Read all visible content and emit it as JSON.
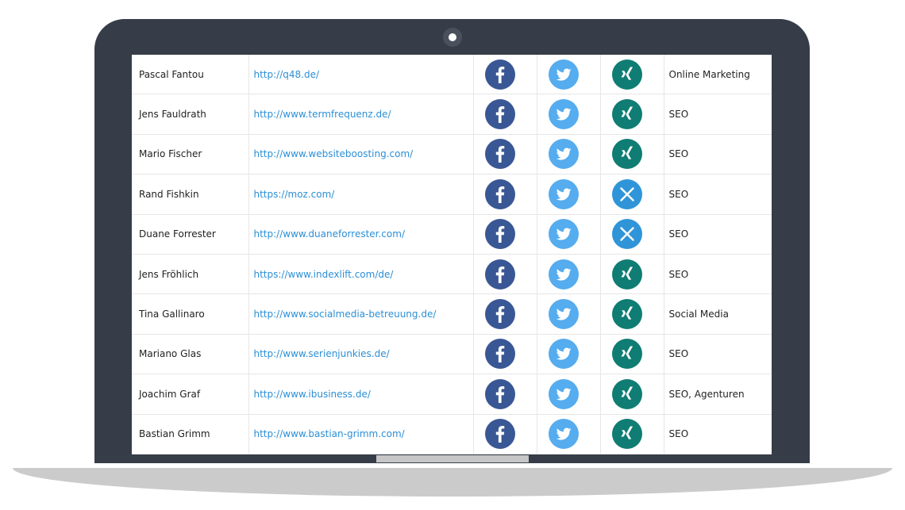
{
  "rows": [
    {
      "name": "Pascal Fantou",
      "url": "http://q48.de/",
      "facebook": "facebook-icon",
      "twitter": "twitter-icon",
      "xing": "xing-icon",
      "category": "Online Marketing"
    },
    {
      "name": "Jens Fauldrath",
      "url": "http://www.termfrequenz.de/",
      "facebook": "facebook-icon",
      "twitter": "twitter-icon",
      "xing": "xing-icon",
      "category": "SEO"
    },
    {
      "name": "Mario Fischer",
      "url": "http://www.websiteboosting.com/",
      "facebook": "facebook-icon",
      "twitter": "twitter-icon",
      "xing": "xing-icon",
      "category": "SEO"
    },
    {
      "name": "Rand Fishkin",
      "url": "https://moz.com/",
      "facebook": "facebook-icon",
      "twitter": "twitter-icon",
      "xing": "close-icon",
      "category": "SEO"
    },
    {
      "name": "Duane Forrester",
      "url": "http://www.duaneforrester.com/",
      "facebook": "facebook-icon",
      "twitter": "twitter-icon",
      "xing": "close-icon",
      "category": "SEO"
    },
    {
      "name": "Jens Fröhlich",
      "url": "https://www.indexlift.com/de/",
      "facebook": "facebook-icon",
      "twitter": "twitter-icon",
      "xing": "xing-icon",
      "category": "SEO"
    },
    {
      "name": "Tina Gallinaro",
      "url": "http://www.socialmedia-betreuung.de/",
      "facebook": "facebook-icon",
      "twitter": "twitter-icon",
      "xing": "xing-icon",
      "category": "Social Media"
    },
    {
      "name": "Mariano Glas",
      "url": "http://www.serienjunkies.de/",
      "facebook": "facebook-icon",
      "twitter": "twitter-icon",
      "xing": "xing-icon",
      "category": "SEO"
    },
    {
      "name": "Joachim Graf",
      "url": "http://www.ibusiness.de/",
      "facebook": "facebook-icon",
      "twitter": "twitter-icon",
      "xing": "xing-icon",
      "category": "SEO, Agenturen"
    },
    {
      "name": "Bastian Grimm",
      "url": "http://www.bastian-grimm.com/",
      "facebook": "facebook-icon",
      "twitter": "twitter-icon",
      "xing": "xing-icon",
      "category": "SEO"
    }
  ],
  "colors": {
    "bezel": "#363d48",
    "link": "#2b8fd6",
    "facebook": "#3a5795",
    "twitter": "#55acee",
    "xing": "#0f7d73",
    "unavailable": "#2f95d8"
  }
}
